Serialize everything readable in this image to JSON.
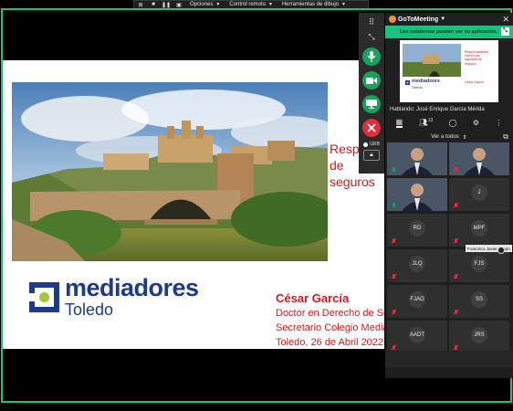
{
  "share_toolbar": {
    "icons": [
      "grid-icon",
      "stop-icon",
      "pause-icon",
      "screen-icon"
    ],
    "menus": [
      {
        "label": "Opciones"
      },
      {
        "label": "Control remoto"
      },
      {
        "label": "Herramientas de dibujo"
      }
    ]
  },
  "slide": {
    "heading_lines": [
      "Resp",
      "de",
      "seguros"
    ],
    "logo": {
      "brand": "mediadores",
      "city": "Toledo",
      "colors": {
        "navy": "#1e3a8a",
        "lime": "#a3c93a"
      }
    },
    "presenter": {
      "name": "César García",
      "line1": "Doctor en Derecho de Segur",
      "line2": "Secretario Colegio Mediado",
      "line3": "Toledo, 26 de Abril 2022"
    },
    "accent_color": "#d7181e"
  },
  "controls": {
    "recording_label": "GRB",
    "icons": [
      "collapse-icon",
      "microphone-icon",
      "camera-icon",
      "screen-share-icon",
      "leave-icon",
      "lock-icon"
    ]
  },
  "panel": {
    "app_name": "GoToMeeting",
    "notice": "Los asistentes pueden ver su aplicación.",
    "speaking": "Hablando: José Enrique García Mérida",
    "attendee_count": "13",
    "view_label": "Ver a todos",
    "preview_slide": {
      "title_lines": [
        "Responsabilidad",
        "civil en las",
        "agencias de",
        "seguros"
      ],
      "brand": "mediadores",
      "city": "Toledo",
      "presenter": "César García"
    },
    "tiles": [
      {
        "initials": "",
        "video": true,
        "mic": "on"
      },
      {
        "initials": "",
        "video": true,
        "mic": "muted"
      },
      {
        "initials": "",
        "video": true,
        "mic": "on"
      },
      {
        "initials": "J",
        "video": false,
        "mic": "muted"
      },
      {
        "initials": "RD",
        "video": false,
        "mic": "muted"
      },
      {
        "initials": "MPF",
        "video": false,
        "mic": "muted"
      },
      {
        "initials": "JLQ",
        "video": false,
        "mic": "muted"
      },
      {
        "initials": "FJS",
        "video": false,
        "mic": "muted"
      },
      {
        "initials": "FJAO",
        "video": false,
        "mic": "muted"
      },
      {
        "initials": "SS",
        "video": false,
        "mic": "muted"
      },
      {
        "initials": "AADT",
        "video": false,
        "mic": "muted"
      },
      {
        "initials": "JRS",
        "video": false,
        "mic": "muted"
      }
    ],
    "tooltip": "Francisco Javier Simón"
  }
}
